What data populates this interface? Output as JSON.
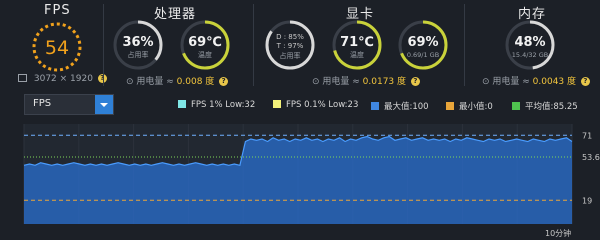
{
  "fps": {
    "header": "FPS",
    "value": "54",
    "resolution": "3072 × 1920",
    "ring_color": "#f0a11c"
  },
  "cpu": {
    "header": "处理器",
    "usage_value": "36%",
    "usage_label": "占用率",
    "usage_fraction": 0.36,
    "temp_value": "69℃",
    "temp_label": "温度",
    "temp_fraction": 0.69,
    "power_label": "用电量 ≈ ",
    "power_value": "0.008 度"
  },
  "gpu": {
    "header": "显卡",
    "d_line": "D : 85%",
    "t_line": "T : 97%",
    "usage_label": "占用率",
    "usage_fraction": 0.85,
    "temp_value": "71℃",
    "temp_label": "温度",
    "temp_fraction": 0.71,
    "mem_value": "69%",
    "mem_sub": "0.69/1 GB",
    "mem_fraction": 0.69,
    "power_label": "用电量 ≈ ",
    "power_value": "0.0173 度"
  },
  "memory": {
    "header": "内存",
    "value": "48%",
    "sub": "15.4/32 GB",
    "fraction": 0.48,
    "power_label": "用电量 ≈ ",
    "power_value": "0.0043 度"
  },
  "chart_controls": {
    "dropdown_value": "FPS"
  },
  "legend": [
    {
      "label": "FPS 1% Low:32",
      "color": "#7fe6e6"
    },
    {
      "label": "FPS 0.1% Low:23",
      "color": "#f2f07a"
    },
    {
      "label": "最大值:100",
      "color": "#3f86e0"
    },
    {
      "label": "最小值:0",
      "color": "#e8a53a"
    },
    {
      "label": "平均值:85.25",
      "color": "#4fc24f"
    }
  ],
  "chart_data": {
    "type": "area",
    "series": [
      {
        "values": [
          47,
          48,
          47,
          49,
          48,
          47,
          48,
          47,
          48,
          49,
          48,
          47,
          48,
          47,
          48,
          47,
          48,
          49,
          48,
          47,
          48,
          47,
          48,
          47,
          48,
          49,
          48,
          47,
          48,
          47,
          48,
          49,
          48,
          47,
          48,
          47,
          48,
          47,
          48,
          47,
          66,
          68,
          67,
          68,
          66,
          69,
          67,
          68,
          66,
          68,
          67,
          69,
          67,
          68,
          66,
          68,
          67,
          69,
          66,
          68,
          67,
          69,
          70,
          68,
          67,
          69,
          70,
          67,
          68,
          69,
          67,
          68,
          69,
          67,
          68,
          67,
          68,
          66,
          68,
          67,
          69,
          68,
          67,
          66,
          68,
          67,
          68,
          66,
          67,
          68,
          67,
          66,
          68,
          67,
          66,
          68,
          67,
          68,
          69,
          66
        ]
      }
    ],
    "h_lines": [
      {
        "value": 71,
        "label": "71",
        "color": "#6fb0ff",
        "style": "dashed"
      },
      {
        "value": 53.6,
        "label": "53.6",
        "color": "#7ed957",
        "style": "dotted"
      },
      {
        "value": 19,
        "label": "19",
        "color": "#e8a53a",
        "style": "dashed"
      }
    ],
    "xlabel": "10分钟",
    "ylim": [
      0,
      80
    ],
    "fill_color": "#2a6fd0",
    "line_color": "#4a9cff"
  }
}
